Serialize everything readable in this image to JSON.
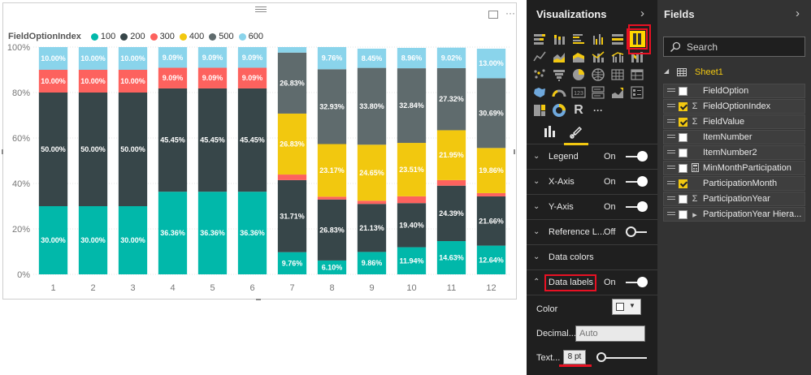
{
  "chart_data": {
    "type": "bar",
    "stacked": "100%",
    "legend_title": "FieldOptionIndex",
    "legend_position": "top-left",
    "categories": [
      "1",
      "2",
      "3",
      "4",
      "5",
      "6",
      "7",
      "8",
      "9",
      "10",
      "11",
      "12"
    ],
    "ylim": [
      0,
      100
    ],
    "yticks": [
      0,
      20,
      40,
      60,
      80,
      100
    ],
    "ytick_labels": [
      "0%",
      "20%",
      "40%",
      "60%",
      "80%",
      "100%"
    ],
    "grid": true,
    "series": [
      {
        "name": "100",
        "color": "#01b8aa",
        "values": [
          30.0,
          30.0,
          30.0,
          36.36,
          36.36,
          36.36,
          9.76,
          6.1,
          9.86,
          11.94,
          14.63,
          12.64
        ],
        "labels": [
          "30.00%",
          "30.00%",
          "30.00%",
          "36.36%",
          "36.36%",
          "36.36%",
          "9.76%",
          "6.10%",
          "9.86%",
          "11.94%",
          "14.63%",
          "12.64%"
        ]
      },
      {
        "name": "200",
        "color": "#374649",
        "values": [
          50.0,
          50.0,
          50.0,
          45.45,
          45.45,
          45.45,
          31.71,
          26.83,
          21.13,
          19.4,
          24.39,
          21.66
        ],
        "labels": [
          "50.00%",
          "50.00%",
          "50.00%",
          "45.45%",
          "45.45%",
          "45.45%",
          "31.71%",
          "26.83%",
          "21.13%",
          "19.40%",
          "24.39%",
          "21.66%"
        ]
      },
      {
        "name": "300",
        "color": "#fd625e",
        "values": [
          10.0,
          10.0,
          10.0,
          9.09,
          9.09,
          9.09,
          2.44,
          1.22,
          1.41,
          2.99,
          2.44,
          1.44
        ],
        "labels": [
          "10.00%",
          "10.00%",
          "10.00%",
          "9.09%",
          "9.09%",
          "9.09%",
          "",
          "",
          "",
          "",
          "",
          ""
        ]
      },
      {
        "name": "400",
        "color": "#f2c80f",
        "values": [
          0,
          0,
          0,
          0,
          0,
          0,
          26.83,
          23.17,
          24.65,
          23.51,
          21.95,
          19.86
        ],
        "labels": [
          "",
          "",
          "",
          "",
          "",
          "",
          "26.83%",
          "23.17%",
          "24.65%",
          "23.51%",
          "21.95%",
          "19.86%"
        ]
      },
      {
        "name": "500",
        "color": "#5f6b6d",
        "values": [
          0,
          0,
          0,
          0,
          0,
          0,
          26.83,
          32.93,
          33.8,
          32.84,
          27.32,
          30.69
        ],
        "labels": [
          "",
          "",
          "",
          "",
          "",
          "",
          "26.83%",
          "32.93%",
          "33.80%",
          "32.84%",
          "27.32%",
          "30.69%"
        ]
      },
      {
        "name": "600",
        "color": "#8ad4eb",
        "values": [
          10.0,
          10.0,
          10.0,
          9.09,
          9.09,
          9.09,
          2.43,
          9.76,
          8.45,
          8.96,
          9.02,
          13.0
        ],
        "labels": [
          "10.00%",
          "10.00%",
          "10.00%",
          "9.09%",
          "9.09%",
          "9.09%",
          "",
          "9.76%",
          "8.45%",
          "8.96%",
          "9.02%",
          "13.00%"
        ]
      }
    ]
  },
  "visualizations": {
    "title": "Visualizations",
    "collapse_icon": "chevron-right-icon",
    "icons": [
      "stacked-bar-icon",
      "stacked-column-icon",
      "clustered-bar-icon",
      "clustered-column-icon",
      "100-stacked-bar-icon",
      "100-stacked-column-icon",
      "line-chart-icon",
      "area-chart-icon",
      "stacked-area-icon",
      "line-column-icon",
      "line-clustered-column-icon",
      "ribbon-chart-icon",
      "scatter-chart-icon",
      "funnel-icon",
      "pie-chart-icon",
      "map-icon",
      "table-icon",
      "matrix-icon",
      "filled-map-icon",
      "gauge-icon",
      "card-icon",
      "multi-row-card-icon",
      "kpi-icon",
      "slicer-icon",
      "treemap-icon",
      "donut-icon",
      "r-script-icon",
      "more-icon"
    ],
    "selected_icon": "100-stacked-column-icon",
    "r_label": "R",
    "more_label": "···",
    "card_label": "123",
    "tabs": [
      {
        "name": "fields-tab-icon"
      },
      {
        "name": "format-tab-icon"
      }
    ],
    "sections": [
      {
        "label": "Legend",
        "state": "On",
        "toggle": "on",
        "expanded": false
      },
      {
        "label": "X-Axis",
        "state": "On",
        "toggle": "on",
        "expanded": false
      },
      {
        "label": "Y-Axis",
        "state": "On",
        "toggle": "on",
        "expanded": false
      },
      {
        "label": "Reference L...",
        "state": "Off",
        "toggle": "off",
        "expanded": false
      },
      {
        "label": "Data colors",
        "state": "",
        "toggle": "",
        "expanded": false
      },
      {
        "label": "Data labels",
        "state": "On",
        "toggle": "on",
        "expanded": true
      }
    ],
    "data_labels": {
      "color_label": "Color",
      "color_value": "#ffffff",
      "decimal_label": "Decimal...",
      "decimal_placeholder": "Auto",
      "text_size_label": "Text...",
      "text_size_value": "8 pt"
    }
  },
  "fields": {
    "title": "Fields",
    "collapse_icon": "chevron-right-icon",
    "search_placeholder": "Search",
    "table_name": "Sheet1",
    "items": [
      {
        "name": "FieldOption",
        "checked": false,
        "type": ""
      },
      {
        "name": "FieldOptionIndex",
        "checked": true,
        "type": "Σ"
      },
      {
        "name": "FieldValue",
        "checked": true,
        "type": "Σ"
      },
      {
        "name": "ItemNumber",
        "checked": false,
        "type": ""
      },
      {
        "name": "ItemNumber2",
        "checked": false,
        "type": ""
      },
      {
        "name": "MinMonthParticipation",
        "checked": false,
        "type": "calc"
      },
      {
        "name": "ParticipationMonth",
        "checked": true,
        "type": ""
      },
      {
        "name": "ParticipationYear",
        "checked": false,
        "type": "Σ"
      },
      {
        "name": "ParticipationYear Hiera...",
        "checked": false,
        "type": "hierarchy"
      }
    ]
  }
}
